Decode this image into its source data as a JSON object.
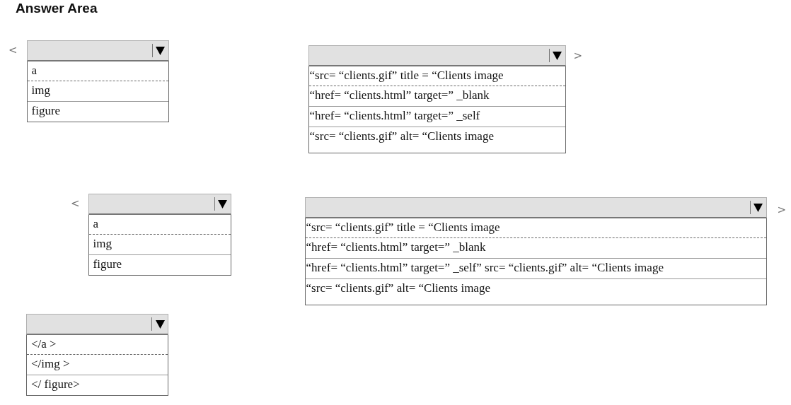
{
  "title": "Answer Area",
  "dropdowns": [
    {
      "prefix": "<",
      "options": [
        "a",
        "img",
        "figure"
      ]
    },
    {
      "suffix": ">",
      "options": [
        "“src= “clients.gif” title = “Clients image",
        "“href= “clients.html” target=” _blank",
        "“href= “clients.html” target=” _self",
        "“src= “clients.gif” alt= “Clients image"
      ]
    },
    {
      "prefix": "<",
      "options": [
        "a",
        "img",
        "figure"
      ]
    },
    {
      "suffix": ">",
      "options": [
        "“src= “clients.gif” title = “Clients image",
        "“href= “clients.html” target=” _blank",
        "“href= “clients.html” target=” _self” src= “clients.gif” alt= “Clients image",
        "“src= “clients.gif” alt= “Clients image"
      ]
    },
    {
      "options": [
        "</a >",
        "</img  >",
        "</ figure>"
      ]
    }
  ]
}
